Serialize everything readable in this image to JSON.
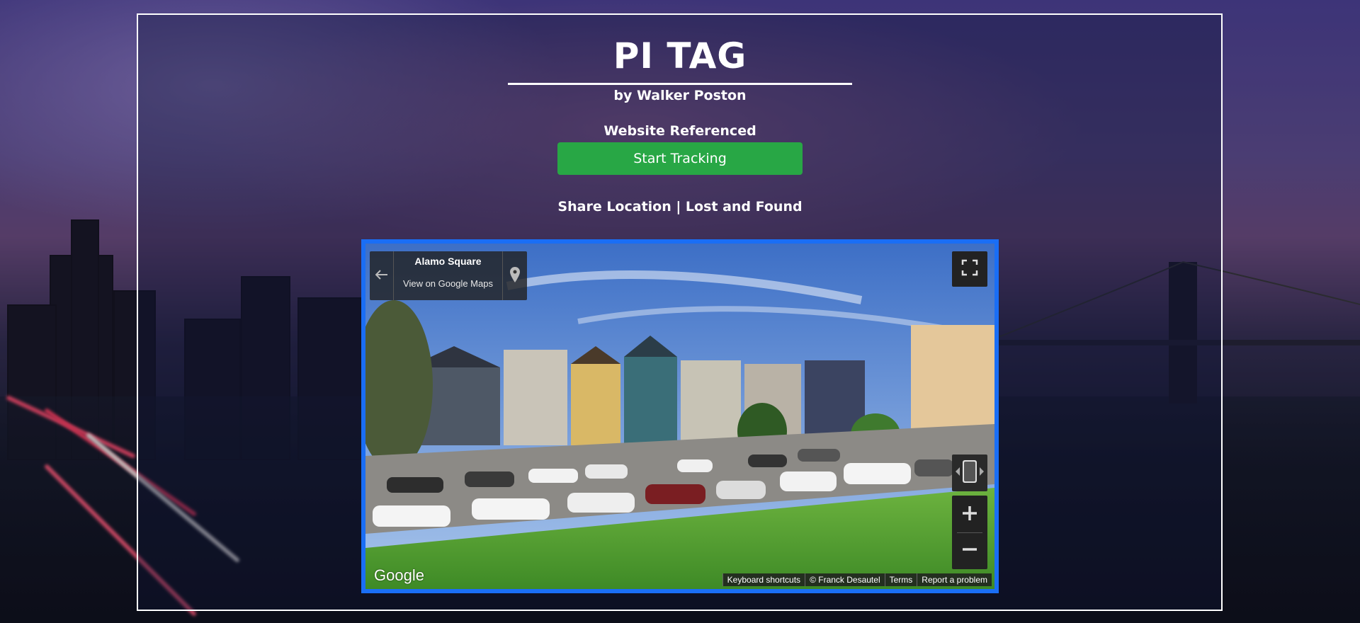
{
  "header": {
    "title": "PI TAG",
    "byline": "by Walker Poston",
    "website_referenced": "Website Referenced",
    "start_tracking_label": "Start Tracking",
    "share_location_label": "Share Location",
    "separator": " | ",
    "lost_found_label": "Lost and Found"
  },
  "map": {
    "place_name": "Alamo Square",
    "view_link": "View on Google Maps",
    "logo_text": "Google",
    "attribution": {
      "keyboard": "Keyboard shortcuts",
      "author": "© Franck Desautel",
      "terms": "Terms",
      "report": "Report a problem"
    },
    "icons": {
      "back": "arrow-left-icon",
      "pin": "location-pin-icon",
      "fullscreen": "fullscreen-icon",
      "pegman": "rotate-view-icon",
      "zoom_in": "plus-icon",
      "zoom_out": "minus-icon"
    }
  },
  "colors": {
    "button_green": "#28a745",
    "map_border": "#1a6ef5",
    "frame_border": "#ffffff"
  }
}
